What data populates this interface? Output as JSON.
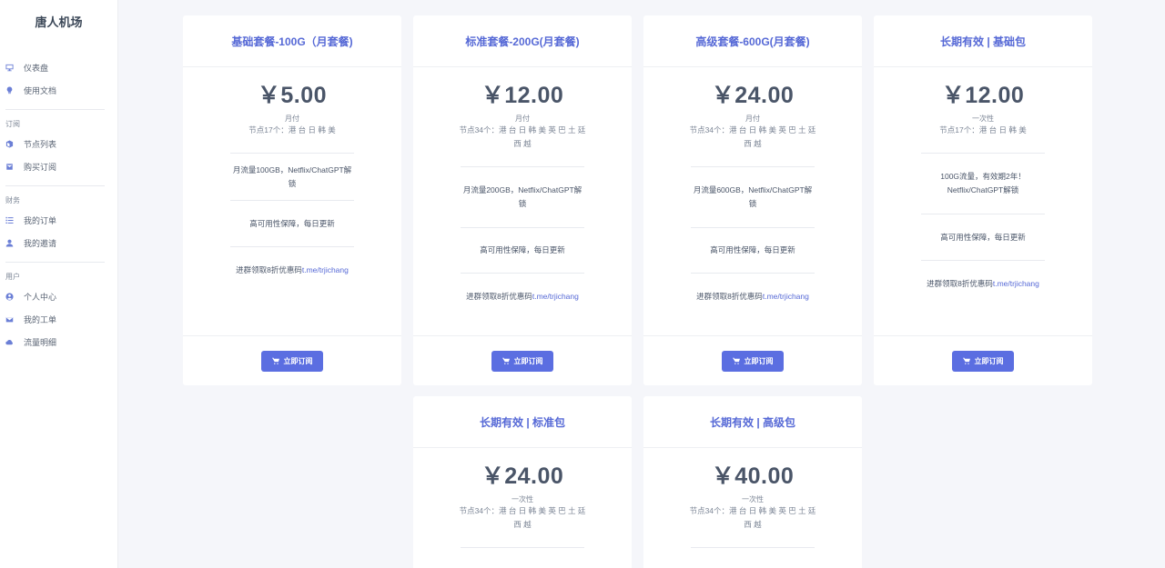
{
  "brand": "唐人机场",
  "nav": {
    "items_top": [
      {
        "label": "仪表盘",
        "icon": "monitor-icon"
      },
      {
        "label": "使用文档",
        "icon": "bulb-icon"
      }
    ],
    "section_sub": "订阅",
    "items_sub": [
      {
        "label": "节点列表",
        "icon": "cube-icon"
      },
      {
        "label": "购买订阅",
        "icon": "cart-icon"
      }
    ],
    "section_fin": "财务",
    "items_fin": [
      {
        "label": "我的订单",
        "icon": "list-icon"
      },
      {
        "label": "我的邀请",
        "icon": "user-icon"
      }
    ],
    "section_user": "用户",
    "items_user": [
      {
        "label": "个人中心",
        "icon": "user-circle-icon"
      },
      {
        "label": "我的工单",
        "icon": "mail-icon"
      },
      {
        "label": "流量明细",
        "icon": "cloud-icon"
      }
    ]
  },
  "plans": [
    {
      "title": "基础套餐-100G（月套餐)",
      "price": "￥5.00",
      "period": "月付",
      "nodes": "节点17个：港 台 日 韩 美",
      "feature1": "月流量100GB，Netflix/ChatGPT解锁",
      "feature2": "高可用性保障，每日更新",
      "promo_text": "进群领取8折优惠码 ",
      "promo_link": "t.me/trjichang",
      "button": "立即订阅"
    },
    {
      "title": "标准套餐-200G(月套餐)",
      "price": "￥12.00",
      "period": "月付",
      "nodes": "节点34个：港 台 日 韩 美 英 巴 土 廷 西 越",
      "feature1": "月流量200GB，Netflix/ChatGPT解锁",
      "feature2": "高可用性保障，每日更新",
      "promo_text": "进群领取8折优惠码 ",
      "promo_link": "t.me/trjichang",
      "button": "立即订阅"
    },
    {
      "title": "高级套餐-600G(月套餐)",
      "price": "￥24.00",
      "period": "月付",
      "nodes": "节点34个：港 台 日 韩 美 英 巴 土 廷 西 越",
      "feature1": "月流量600GB，Netflix/ChatGPT解锁",
      "feature2": "高可用性保障，每日更新",
      "promo_text": "进群领取8折优惠码 ",
      "promo_link": "t.me/trjichang",
      "button": "立即订阅"
    },
    {
      "title": "长期有效 | 基础包",
      "price": "￥12.00",
      "period": "一次性",
      "nodes": "节点17个：港 台 日 韩 美",
      "feature1": "100G流量，有效期2年！Netflix/ChatGPT解锁",
      "feature2": "高可用性保障，每日更新",
      "promo_text": "进群领取8折优惠码 ",
      "promo_link": "t.me/trjichang",
      "button": "立即订阅"
    },
    {
      "title": "长期有效 | 标准包",
      "price": "￥24.00",
      "period": "一次性",
      "nodes": "节点34个：港 台 日 韩 美 英 巴 土 廷 西 越"
    },
    {
      "title": "长期有效 | 高级包",
      "price": "￥40.00",
      "period": "一次性",
      "nodes": "节点34个：港 台 日 韩 美 英 巴 土 廷 西 越"
    }
  ],
  "colors": {
    "accent": "#5b6ee1",
    "title": "#5669d6",
    "background": "#f5f6fa"
  }
}
